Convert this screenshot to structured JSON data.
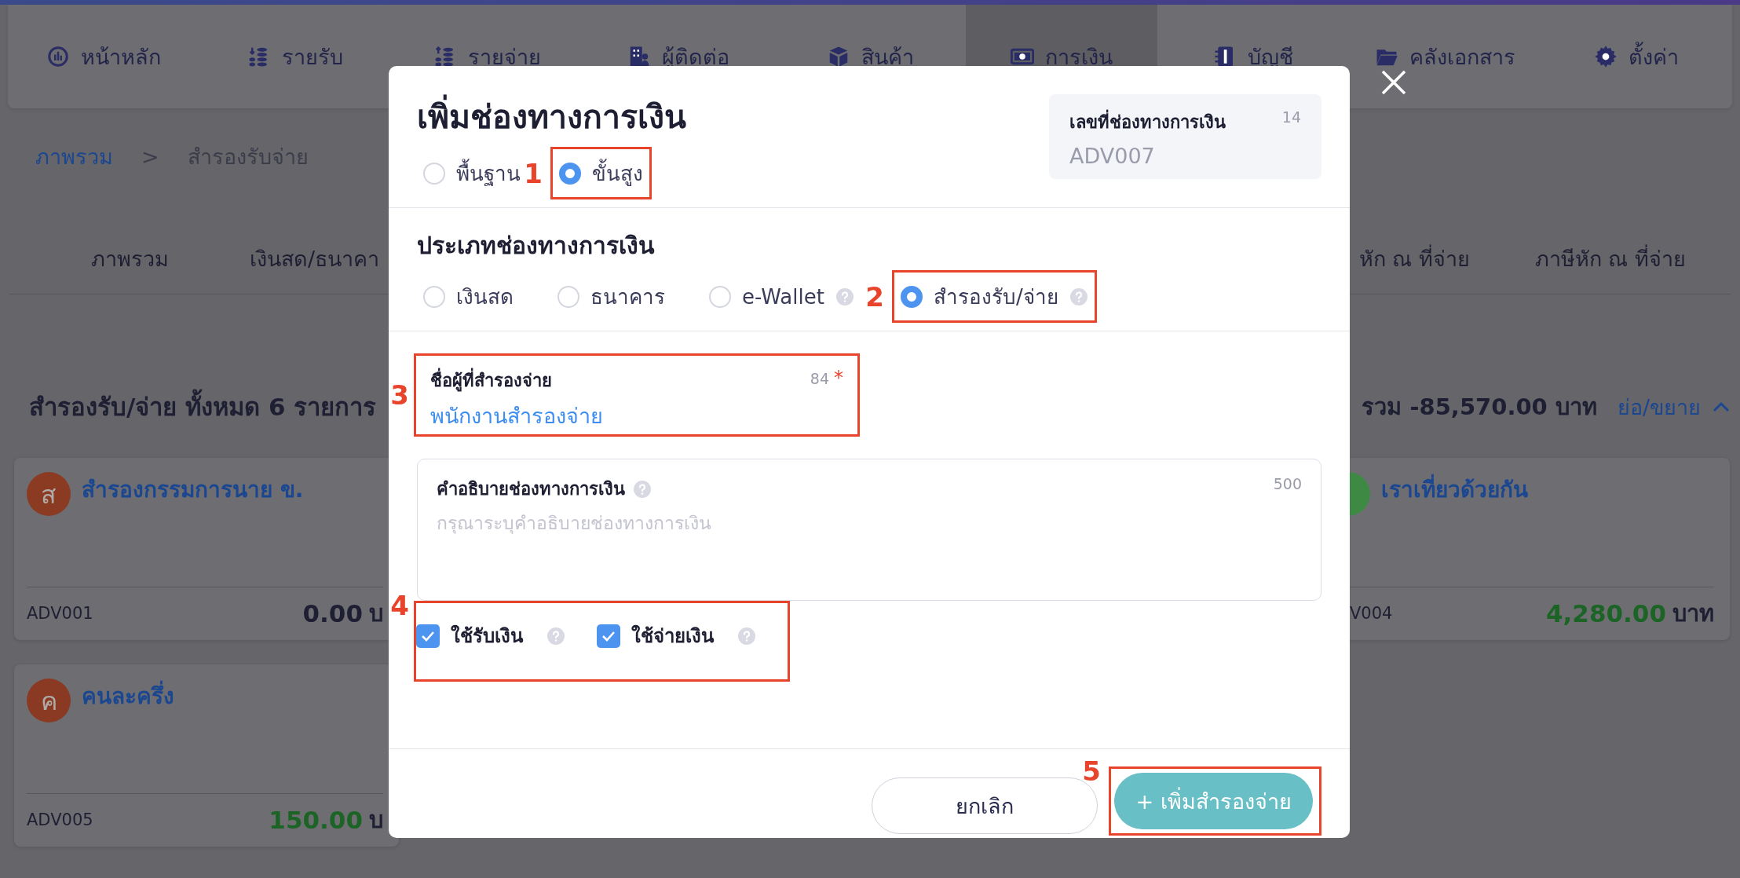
{
  "nav": {
    "items": [
      {
        "label": "หน้าหลัก",
        "selected": false
      },
      {
        "label": "รายรับ",
        "selected": false
      },
      {
        "label": "รายจ่าย",
        "selected": false
      },
      {
        "label": "ผู้ติดต่อ",
        "selected": false
      },
      {
        "label": "สินค้า",
        "selected": false
      },
      {
        "label": "การเงิน",
        "selected": true
      },
      {
        "label": "บัญชี",
        "selected": false
      },
      {
        "label": "คลังเอกสาร",
        "selected": false
      },
      {
        "label": "ตั้งค่า",
        "selected": false
      }
    ]
  },
  "breadcrumb": {
    "items": [
      "ภาพรวม",
      "สำรองรับจ่าย"
    ],
    "separator": ">"
  },
  "tabs": [
    {
      "label": "ภาพรวม"
    },
    {
      "label": "เงินสด/ธนาคา"
    },
    {
      "label": "หัก ณ ที่จ่าย"
    },
    {
      "label": "ภาษีหัก ณ ที่จ่าย"
    }
  ],
  "summary": {
    "title": "สำรองรับ/จ่าย ทั้งหมด 6 รายการ",
    "total": "รวม -85,570.00 บาท",
    "toggle": "ย่อ/ขยาย"
  },
  "cards": [
    {
      "initial": "ส",
      "color": "#8c3b23",
      "name": "สำรองกรรมการนาย ข.",
      "code": "ADV001",
      "amount": "0.00",
      "positive": false,
      "unit": "บ"
    },
    {
      "color": "#3e8a45",
      "name": "เราเที่ยวด้วยกัน",
      "code": "V004",
      "amount": "4,280.00",
      "positive": true,
      "unit": "บาท"
    },
    {
      "initial": "ค",
      "color": "#8a3a22",
      "name": "คนละครึ่ง",
      "code": "ADV005",
      "amount": "150.00",
      "positive": true,
      "unit": "บ"
    }
  ],
  "modal": {
    "title": "เพิ่มช่องทางการเงิน",
    "modes": [
      {
        "label": "พื้นฐาน",
        "selected": false
      },
      {
        "label": "ขั้นสูง",
        "selected": true,
        "callout": "1"
      }
    ],
    "number_box": {
      "label": "เลขที่ช่องทางการเงิน",
      "counter": "14",
      "value": "ADV007"
    },
    "type_section": {
      "title": "ประเภทช่องทางการเงิน",
      "options": [
        {
          "label": "เงินสด",
          "selected": false,
          "help": false
        },
        {
          "label": "ธนาคาร",
          "selected": false,
          "help": false
        },
        {
          "label": "e-Wallet",
          "selected": false,
          "help": true
        },
        {
          "label": "สำรองรับ/จ่าย",
          "selected": true,
          "help": true,
          "callout": "2"
        }
      ]
    },
    "name_field": {
      "label": "ชื่อผู้ที่สำรองจ่าย",
      "counter": "84",
      "required_mark": "*",
      "value": "พนักงานสำรองจ่าย",
      "callout": "3"
    },
    "description_field": {
      "label": "คำอธิบายช่องทางการเงิน",
      "help": true,
      "counter": "500",
      "placeholder": "กรุณาระบุคำอธิบายช่องทางการเงิน"
    },
    "usage": {
      "callout": "4",
      "options": [
        {
          "label": "ใช้รับเงิน",
          "checked": true,
          "help": true
        },
        {
          "label": "ใช้จ่ายเงิน",
          "checked": true,
          "help": true
        }
      ]
    },
    "buttons": [
      {
        "label": "ยกเลิก",
        "kind": "secondary"
      },
      {
        "label": "+ เพิ่มสำรองจ่าย",
        "kind": "primary",
        "callout": "5"
      }
    ]
  }
}
